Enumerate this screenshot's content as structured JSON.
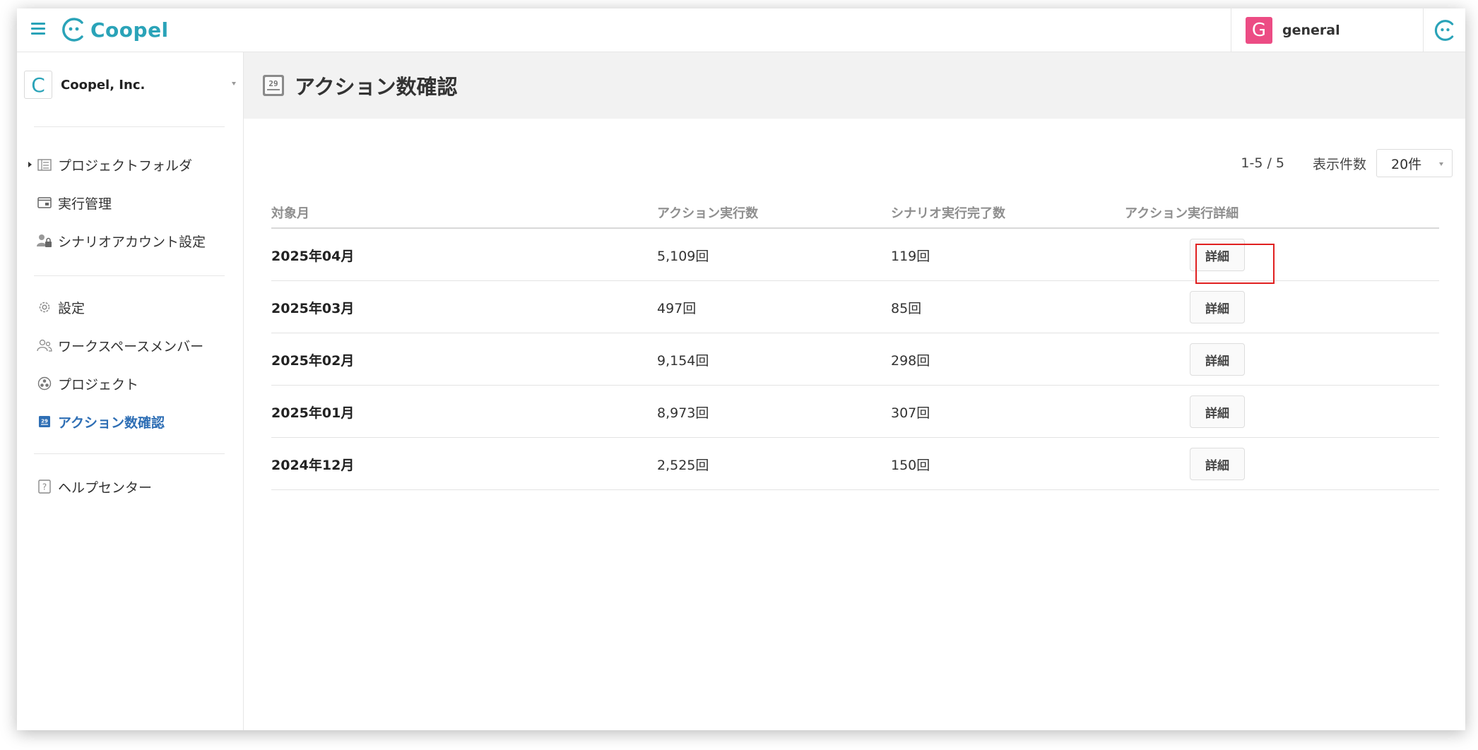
{
  "app": {
    "logo_text": "Coopel",
    "user": {
      "avatar_letter": "G",
      "name": "general"
    }
  },
  "sidebar": {
    "org": {
      "badge": "C",
      "name": "Coopel, Inc."
    },
    "groups": [
      [
        {
          "label": "プロジェクトフォルダ",
          "icon": "folder-list-icon",
          "expandable": true
        },
        {
          "label": "実行管理",
          "icon": "window-icon"
        },
        {
          "label": "シナリオアカウント設定",
          "icon": "user-lock-icon"
        }
      ],
      [
        {
          "label": "設定",
          "icon": "gear-icon"
        },
        {
          "label": "ワークスペースメンバー",
          "icon": "users-icon"
        },
        {
          "label": "プロジェクト",
          "icon": "project-icon"
        },
        {
          "label": "アクション数確認",
          "icon": "calendar-icon",
          "active": true
        }
      ],
      [
        {
          "label": "ヘルプセンター",
          "icon": "help-icon"
        }
      ]
    ]
  },
  "page": {
    "title": "アクション数確認",
    "title_icon": "calendar-icon",
    "pager": {
      "range": "1-5 / 5",
      "size_label": "表示件数",
      "size_value": "20件"
    },
    "table": {
      "headers": [
        "対象月",
        "アクション実行数",
        "シナリオ実行完了数",
        "アクション実行詳細"
      ],
      "detail_label": "詳細",
      "rows": [
        {
          "month": "2025年04月",
          "actions": "5,109回",
          "completed": "119回"
        },
        {
          "month": "2025年03月",
          "actions": "497回",
          "completed": "85回"
        },
        {
          "month": "2025年02月",
          "actions": "9,154回",
          "completed": "298回"
        },
        {
          "month": "2025年01月",
          "actions": "8,973回",
          "completed": "307回"
        },
        {
          "month": "2024年12月",
          "actions": "2,525回",
          "completed": "150回"
        }
      ]
    }
  },
  "colors": {
    "brand": "#2aa3b8",
    "active_nav": "#2f6fb5",
    "avatar": "#ec4c84",
    "highlight": "#e02020"
  }
}
